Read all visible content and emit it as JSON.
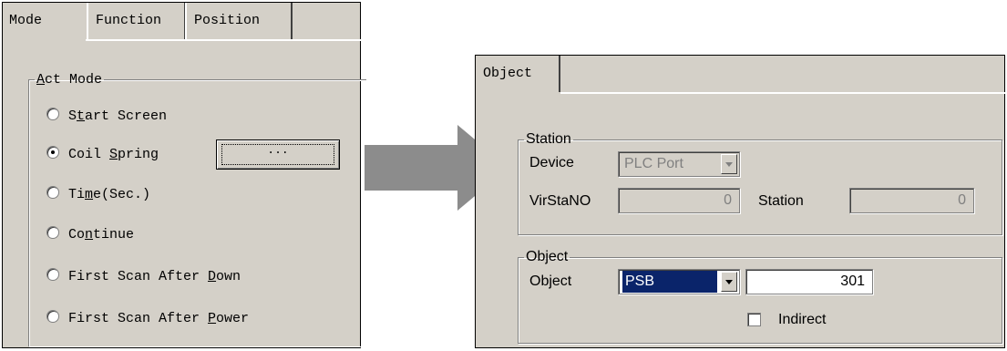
{
  "left_dialog": {
    "tabs": [
      "Mode",
      "Function",
      "Position"
    ],
    "group_title_prefix": "",
    "group_title_u": "A",
    "group_title_rest": "ct Mode",
    "options": [
      {
        "pre": "S",
        "u": "t",
        "post": "art Screen",
        "checked": false
      },
      {
        "pre": "Coil ",
        "u": "S",
        "post": "pring",
        "checked": true
      },
      {
        "pre": "Ti",
        "u": "m",
        "post": "e(Sec.)",
        "checked": false
      },
      {
        "pre": "Co",
        "u": "n",
        "post": "tinue",
        "checked": false
      },
      {
        "pre": "First Scan After ",
        "u": "D",
        "post": "own",
        "checked": false
      },
      {
        "pre": "First Scan After ",
        "u": "P",
        "post": "ower",
        "checked": false
      }
    ],
    "ellipsis_button": "..."
  },
  "right_dialog": {
    "tab": "Object",
    "station_group": {
      "title": "Station",
      "device_label": "Device",
      "device_value": "PLC Port",
      "virsta_label": "VirStaNO",
      "virsta_value": "0",
      "station_label": "Station",
      "station_value": "0"
    },
    "object_group": {
      "title": "Object",
      "object_label": "Object",
      "object_type": "PSB",
      "object_address": "301",
      "indirect_label": "Indirect",
      "indirect_checked": false
    }
  },
  "colors": {
    "dialog_bg": "#d4d0c8",
    "selection": "#0a246a",
    "arrow": "#8c8c8c",
    "disabled_text": "#808080"
  }
}
